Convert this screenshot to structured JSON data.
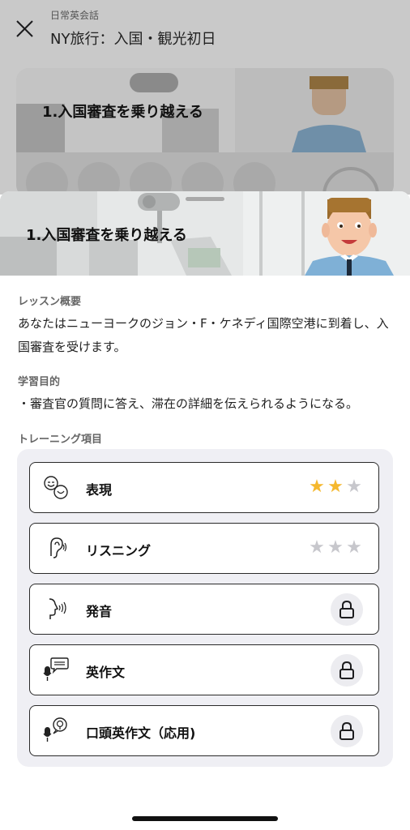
{
  "header": {
    "subtitle": "日常英会話",
    "title": "NY旅行：入国・観光初日",
    "close_icon": "close-icon"
  },
  "background_card": {
    "title": "1.入国審査を乗り越える"
  },
  "sheet": {
    "banner_title": "1.入国審査を乗り越える",
    "overview": {
      "label": "レッスン概要",
      "text": "あなたはニューヨークのジョン・F・ケネディ国際空港に到着し、入国審査を受けます。"
    },
    "goal": {
      "label": "学習目的",
      "text": "・審査官の質問に答え、滞在の詳細を伝えられるようになる。"
    },
    "training": {
      "label": "トレーニング項目",
      "items": [
        {
          "label": "表現",
          "icon": "expression-faces-icon",
          "stars_filled": 2,
          "stars_total": 3,
          "locked": false
        },
        {
          "label": "リスニング",
          "icon": "listening-ear-icon",
          "stars_filled": 0,
          "stars_total": 3,
          "locked": false
        },
        {
          "label": "発音",
          "icon": "pronunciation-icon",
          "locked": true
        },
        {
          "label": "英作文",
          "icon": "composition-mic-icon",
          "locked": true
        },
        {
          "label": "口頭英作文（応用)",
          "icon": "oral-composition-icon",
          "locked": true
        }
      ]
    }
  },
  "colors": {
    "star_filled": "#f5b82e",
    "star_empty": "#c7c7cc",
    "lock_bg": "#ececf0",
    "training_bg": "#efeff4"
  }
}
